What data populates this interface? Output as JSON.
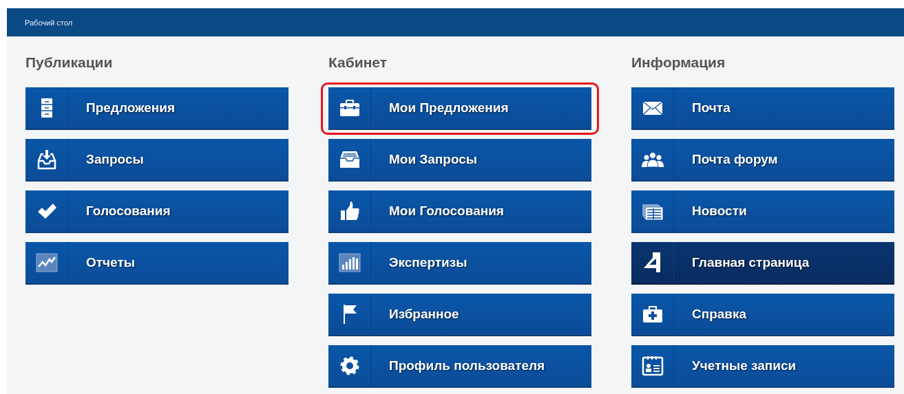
{
  "top_bar": {
    "title": "Рабочий стол"
  },
  "sections": [
    {
      "heading": "Публикации",
      "items": [
        {
          "label": "Предложения",
          "selected": false,
          "highlighted": false
        },
        {
          "label": "Запросы",
          "selected": false,
          "highlighted": false
        },
        {
          "label": "Голосования",
          "selected": false,
          "highlighted": false
        },
        {
          "label": "Отчеты",
          "selected": false,
          "highlighted": false
        }
      ]
    },
    {
      "heading": "Кабинет",
      "items": [
        {
          "label": "Мои Предложения",
          "selected": false,
          "highlighted": true
        },
        {
          "label": "Мои Запросы",
          "selected": false,
          "highlighted": false
        },
        {
          "label": "Мои Голосования",
          "selected": false,
          "highlighted": false
        },
        {
          "label": "Экспертизы",
          "selected": false,
          "highlighted": false
        },
        {
          "label": "Избранное",
          "selected": false,
          "highlighted": false
        },
        {
          "label": "Профиль пользователя",
          "selected": false,
          "highlighted": false
        }
      ]
    },
    {
      "heading": "Информация",
      "items": [
        {
          "label": "Почта",
          "selected": false,
          "highlighted": false
        },
        {
          "label": "Почта форум",
          "selected": false,
          "highlighted": false
        },
        {
          "label": "Новости",
          "selected": false,
          "highlighted": false
        },
        {
          "label": "Главная страница",
          "selected": true,
          "highlighted": false
        },
        {
          "label": "Справка",
          "selected": false,
          "highlighted": false
        },
        {
          "label": "Учетные записи",
          "selected": false,
          "highlighted": false
        }
      ]
    }
  ]
}
